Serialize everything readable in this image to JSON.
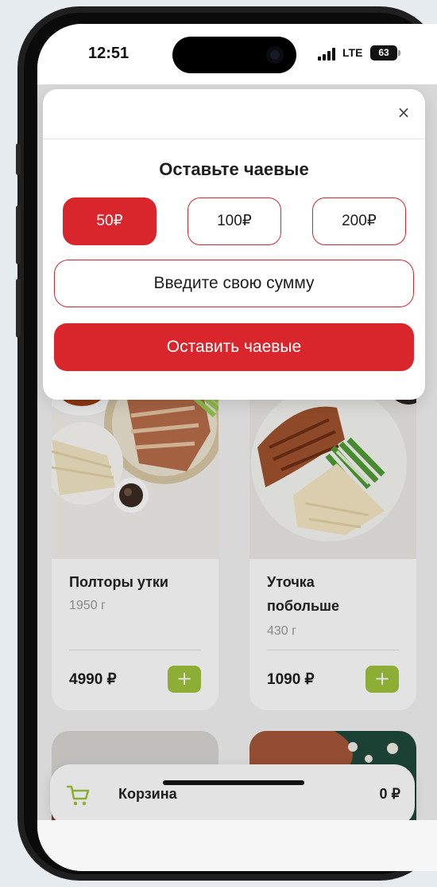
{
  "status_bar": {
    "time": "12:51",
    "network": "LTE",
    "battery": "63"
  },
  "tips_modal": {
    "close_label": "×",
    "title": "Оставьте чаевые",
    "options": [
      {
        "label": "50₽",
        "selected": true
      },
      {
        "label": "100₽",
        "selected": false
      },
      {
        "label": "200₽",
        "selected": false
      }
    ],
    "custom_amount_placeholder": "Введите свою сумму",
    "submit_label": "Оставить чаевые"
  },
  "products": [
    {
      "name": "Полторы утки",
      "weight": "1950 г",
      "price": "4990 ₽"
    },
    {
      "name_line1": "Уточка",
      "name_line2": "побольше",
      "weight": "430 г",
      "price": "1090 ₽"
    }
  ],
  "add_label": "+",
  "cart": {
    "label": "Корзина",
    "total": "0 ₽"
  },
  "colors": {
    "accent_red": "#d9262d",
    "add_green": "#9fc43b"
  }
}
